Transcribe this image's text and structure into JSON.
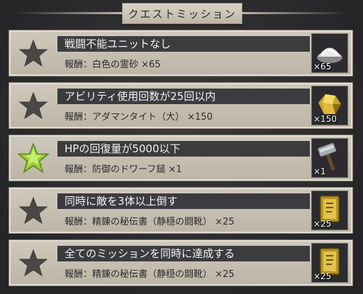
{
  "header": {
    "title": "クエストミッション"
  },
  "missions": [
    {
      "title": "戦闘不能ユニットなし",
      "reward": "報酬：白色の霊砂 ×65",
      "count": "×65",
      "achieved": false,
      "item_icon": "white-sand-icon"
    },
    {
      "title": "アビリティ使用回数が25回以内",
      "reward": "報酬：アダマンタイト（大） ×150",
      "count": "×150",
      "achieved": false,
      "item_icon": "adamantite-icon"
    },
    {
      "title": "HPの回復量が5000以下",
      "reward": "報酬：防御のドワーフ鎚 ×1",
      "count": "×1",
      "achieved": true,
      "item_icon": "dwarf-hammer-icon"
    },
    {
      "title": "同時に敵を3体以上倒す",
      "reward": "報酬：精錬の秘伝書（静穏の闘靴） ×25",
      "count": "×25",
      "achieved": false,
      "item_icon": "secret-book-icon"
    },
    {
      "title": "全てのミッションを同時に達成する",
      "reward": "報酬：精錬の秘伝書（静穏の闘靴） ×25",
      "count": "×25",
      "achieved": false,
      "item_icon": "secret-book-icon"
    }
  ],
  "colors": {
    "achieved_star": "#9ccb3c",
    "empty_star": "#4a4845",
    "title_bar": "#3c3c3f",
    "panel": "#c8c2b5"
  }
}
